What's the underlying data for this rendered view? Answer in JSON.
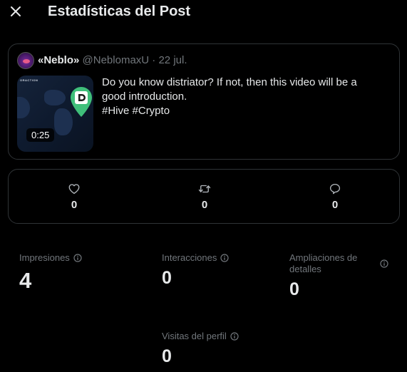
{
  "header": {
    "close_icon": "close-icon",
    "title": "Estadísticas del Post"
  },
  "post": {
    "author_name": "«Neblo»",
    "author_handle": "@NeblomaxU",
    "separator": "·",
    "date": "22 jul.",
    "video_duration": "0:25",
    "thumbnail_tag": "ORACTION",
    "text_lines": [
      "Do you know distriator? If not, then this video will be a",
      "good introduction.",
      "#Hive #Crypto"
    ]
  },
  "engagement": {
    "likes": "0",
    "reposts": "0",
    "replies": "0"
  },
  "metrics": {
    "impressions": {
      "label": "Impresiones",
      "value": "4"
    },
    "interactions": {
      "label": "Interacciones",
      "value": "0"
    },
    "detail_expands": {
      "label_line1": "Ampliaciones de",
      "label_line2": "detalles",
      "value": "0"
    },
    "profile_visits": {
      "label": "Visitas del perfil",
      "value": "0"
    }
  },
  "colors": {
    "background": "#000000",
    "text": "#e7e9ea",
    "muted": "#71767b",
    "border": "#2f3336",
    "pin_green": "#3fbf7a"
  }
}
